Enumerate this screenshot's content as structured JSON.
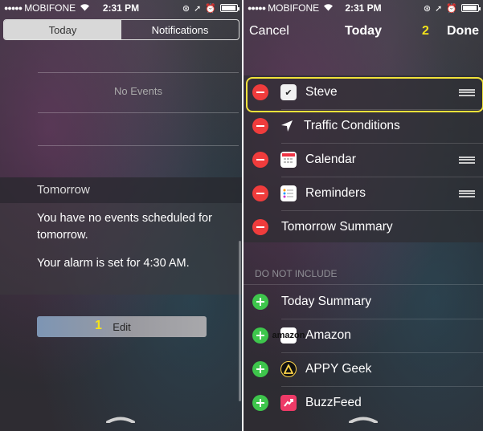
{
  "status_bar": {
    "signal": "●●●●●",
    "carrier": "MOBIFONE",
    "time": "2:31 PM"
  },
  "left_screen": {
    "segments": [
      {
        "label": "Today",
        "active": true
      },
      {
        "label": "Notifications",
        "active": false
      }
    ],
    "no_events": "No Events",
    "tomorrow_header": "Tomorrow",
    "tomorrow_text": "You have no events scheduled for tomorrow.",
    "alarm_text": "Your alarm is set for 4:30 AM.",
    "edit_button": "Edit",
    "step_badge": "1"
  },
  "right_screen": {
    "cancel": "Cancel",
    "title": "Today",
    "done": "Done",
    "step_badge": "2",
    "included": [
      {
        "label": "Steve",
        "icon": "steve-app-icon",
        "grip": true
      },
      {
        "label": "Traffic Conditions",
        "icon": "location-arrow-icon",
        "grip": false
      },
      {
        "label": "Calendar",
        "icon": "calendar-app-icon",
        "grip": true
      },
      {
        "label": "Reminders",
        "icon": "reminders-app-icon",
        "grip": true
      },
      {
        "label": "Tomorrow Summary",
        "icon": "",
        "grip": false
      }
    ],
    "do_not_include_header": "DO NOT INCLUDE",
    "not_included": [
      {
        "label": "Today Summary",
        "icon": ""
      },
      {
        "label": "Amazon",
        "icon": "amazon-app-icon",
        "icon_text": "amazon"
      },
      {
        "label": "APPY Geek",
        "icon": "appy-geek-app-icon"
      },
      {
        "label": "BuzzFeed",
        "icon": "buzzfeed-app-icon"
      }
    ]
  },
  "colors": {
    "highlight": "#f1e23a",
    "remove": "#f03c3c",
    "add": "#3ec64c"
  }
}
